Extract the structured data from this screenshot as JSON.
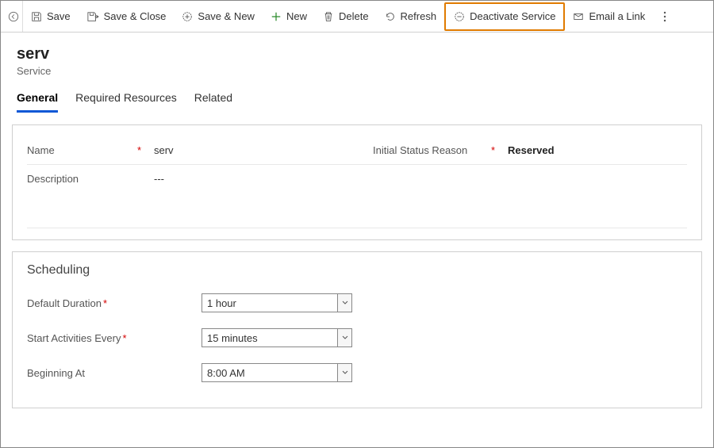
{
  "toolbar": {
    "save": "Save",
    "save_close": "Save & Close",
    "save_new": "Save & New",
    "new": "New",
    "delete": "Delete",
    "refresh": "Refresh",
    "deactivate": "Deactivate Service",
    "email_link": "Email a Link"
  },
  "header": {
    "title": "serv",
    "entity": "Service"
  },
  "tabs": {
    "general": "General",
    "required_resources": "Required Resources",
    "related": "Related"
  },
  "form": {
    "name_label": "Name",
    "name_value": "serv",
    "initial_status_label": "Initial Status Reason",
    "initial_status_value": "Reserved",
    "description_label": "Description",
    "description_value": "---"
  },
  "scheduling": {
    "heading": "Scheduling",
    "default_duration_label": "Default Duration",
    "default_duration_value": "1 hour",
    "start_activities_label": "Start Activities Every",
    "start_activities_value": "15 minutes",
    "beginning_at_label": "Beginning At",
    "beginning_at_value": "8:00 AM"
  }
}
